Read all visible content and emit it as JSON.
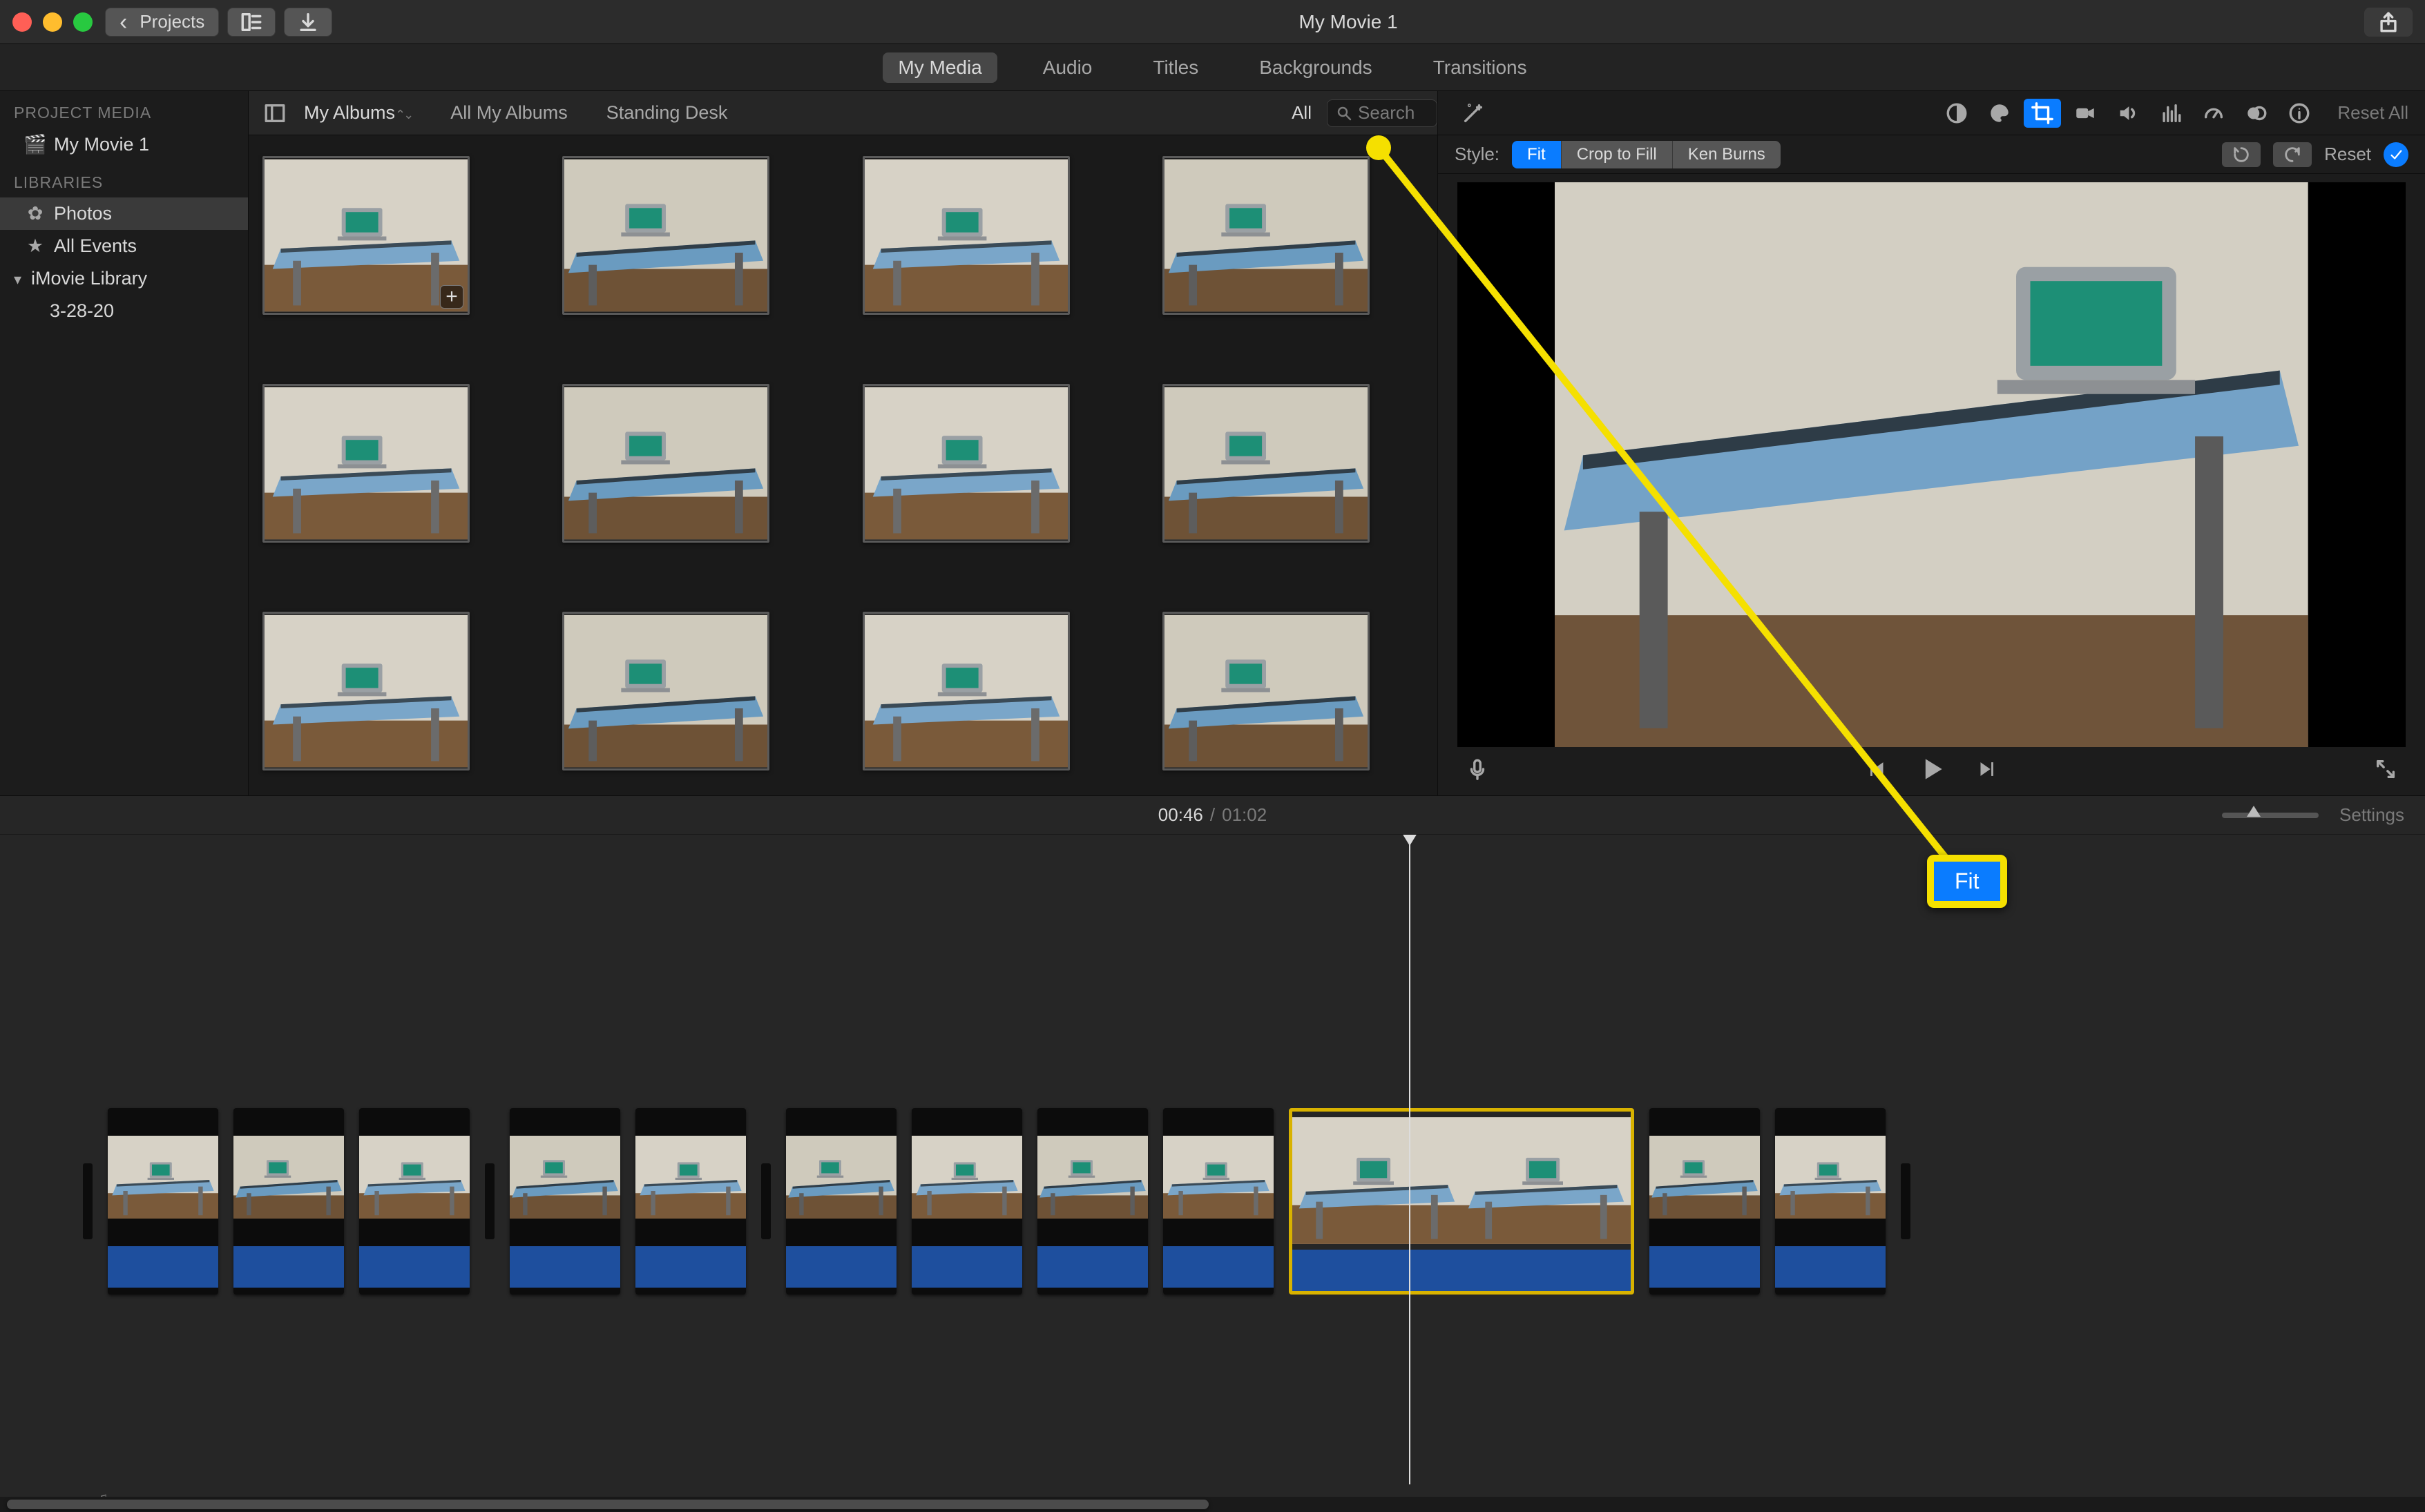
{
  "titlebar": {
    "back_label": "Projects",
    "window_title": "My Movie 1"
  },
  "tabs": {
    "my_media": "My Media",
    "audio": "Audio",
    "titles": "Titles",
    "backgrounds": "Backgrounds",
    "transitions": "Transitions"
  },
  "sidebar": {
    "project_media_hdr": "PROJECT MEDIA",
    "project_name": "My Movie 1",
    "libraries_hdr": "LIBRARIES",
    "photos": "Photos",
    "all_events": "All Events",
    "imovie_library": "iMovie Library",
    "event_date": "3-28-20"
  },
  "browser": {
    "bc1": "My Albums",
    "bc2": "All My Albums",
    "bc3": "Standing Desk",
    "filter_label": "All",
    "search_placeholder": "Search"
  },
  "viewer": {
    "reset_all": "Reset All",
    "style_label": "Style:",
    "style_fit": "Fit",
    "style_crop": "Crop to Fill",
    "style_kb": "Ken Burns",
    "reset": "Reset"
  },
  "timeline": {
    "cur": "00:46",
    "sep": "/",
    "total": "01:02",
    "settings": "Settings"
  },
  "annotation": {
    "fit_label": "Fit"
  }
}
